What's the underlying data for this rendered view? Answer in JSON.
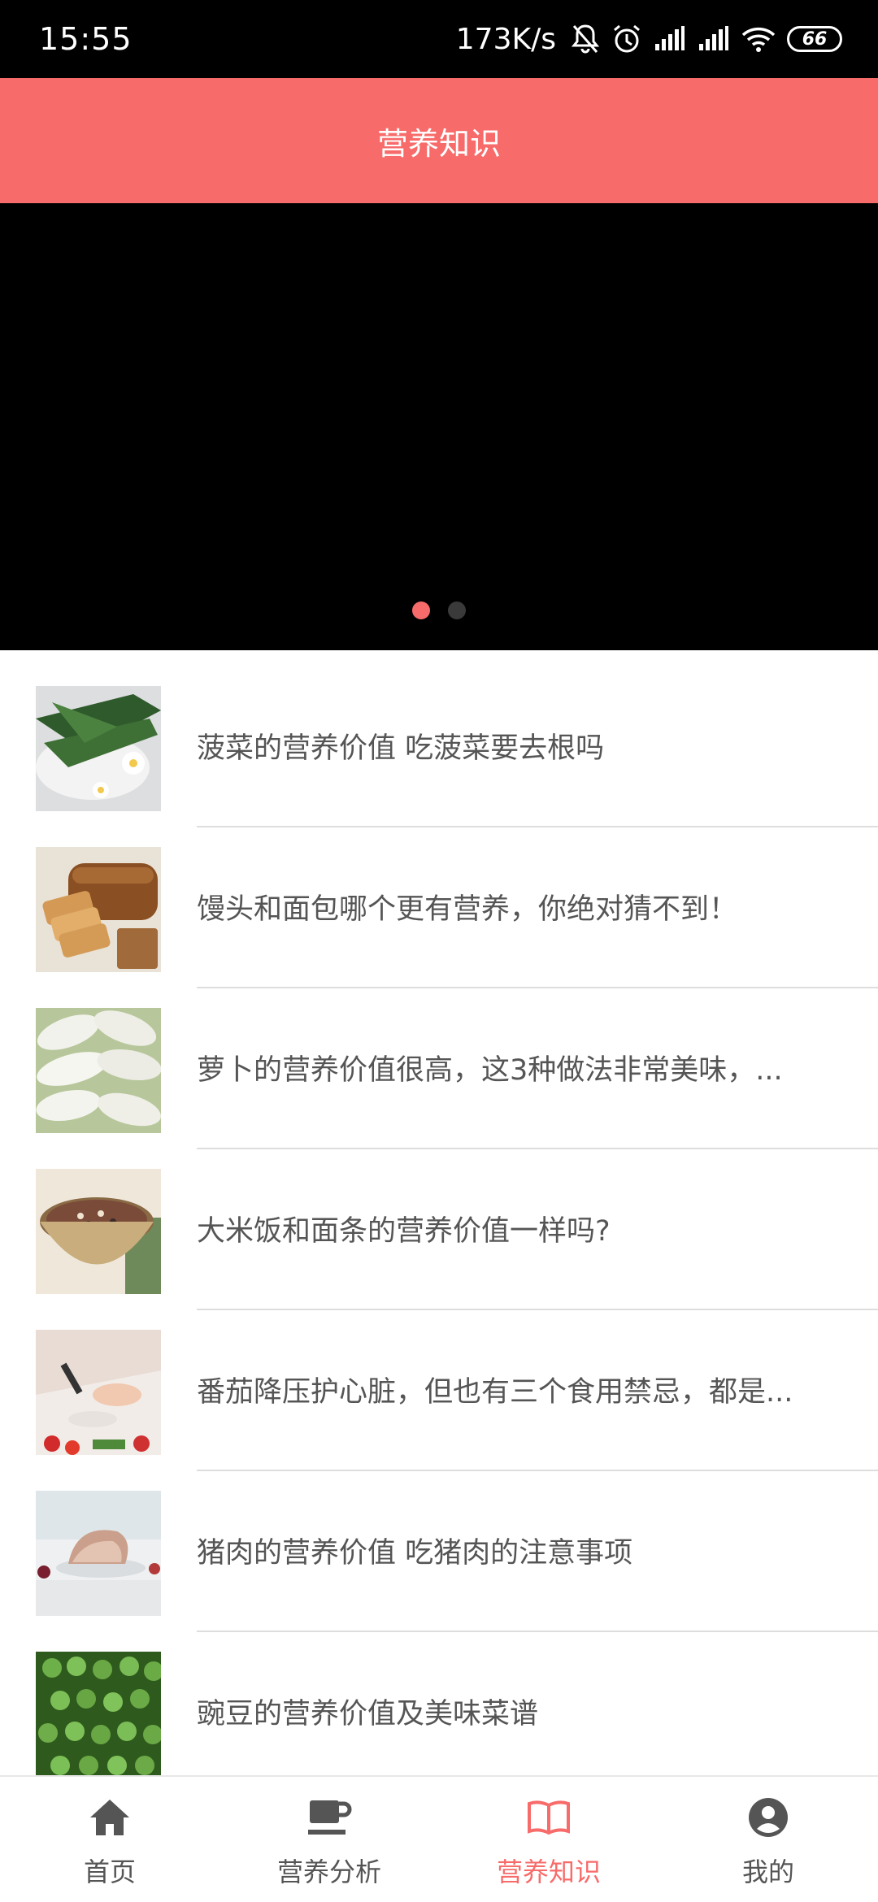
{
  "status_bar": {
    "time": "15:55",
    "net_speed": "173K/s",
    "battery": "66",
    "icons": [
      "bell-off-icon",
      "alarm-icon",
      "signal-icon",
      "signal-icon",
      "wifi-icon",
      "battery-icon"
    ]
  },
  "header": {
    "title": "营养知识"
  },
  "banner": {
    "pages": 2,
    "active_page": 1
  },
  "articles": [
    {
      "title": "菠菜的营养价值 吃菠菜要去根吗",
      "thumb": "spinach"
    },
    {
      "title": "馒头和面包哪个更有营养，你绝对猜不到！",
      "thumb": "bread"
    },
    {
      "title": "萝卜的营养价值很高，这3种做法非常美味，...",
      "thumb": "radish"
    },
    {
      "title": "大米饭和面条的营养价值一样吗?",
      "thumb": "rice-bowl"
    },
    {
      "title": "番茄降压护心脏，但也有三个食用禁忌，都是...",
      "thumb": "tomato"
    },
    {
      "title": "猪肉的营养价值 吃猪肉的注意事项",
      "thumb": "pork"
    },
    {
      "title": "豌豆的营养价值及美味菜谱",
      "thumb": "peas"
    }
  ],
  "nav": {
    "home": "首页",
    "analysis": "营养分析",
    "knowledge": "营养知识",
    "mine": "我的"
  },
  "colors": {
    "accent": "#f76b6a",
    "text": "#555555",
    "divider": "#dddddd"
  }
}
